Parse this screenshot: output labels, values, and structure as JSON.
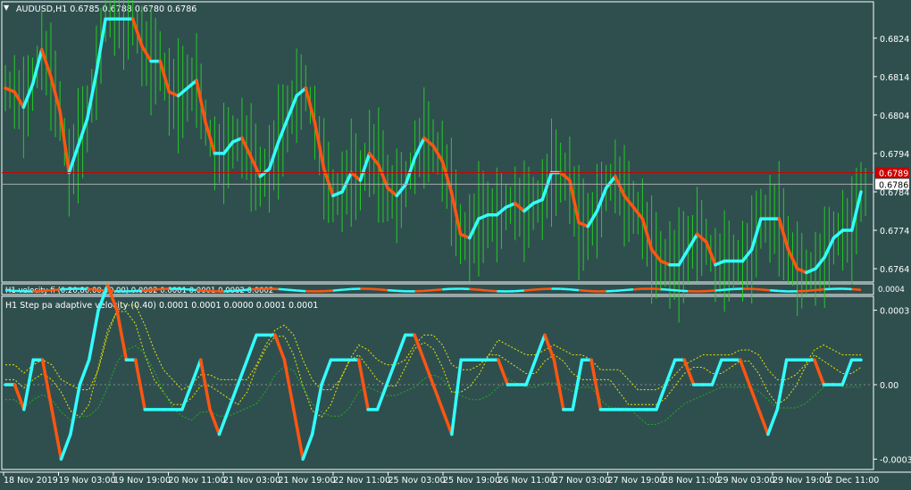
{
  "header": {
    "dropdown_glyph": "▼",
    "symbol_info": "AUDUSD,H1  0.6785 0.6788 0.6780 0.6786"
  },
  "colors": {
    "background": "#2f4f4f",
    "frame": "#ffffff",
    "up": "#33ffff",
    "down": "#ff5511",
    "bars": "#22cc22",
    "level_line": "#cc0000",
    "bid_line": "#aaaaaa",
    "yellow_band": "#e5e500",
    "green_band": "#22aa22"
  },
  "chart_data": [
    {
      "type": "line",
      "name": "price-panel",
      "ylim": [
        0.6761,
        0.6833
      ],
      "yticks": [
        "0.6824",
        "0.6814",
        "0.6804",
        "0.6794",
        "0.6784",
        "0.6774",
        "0.6764"
      ],
      "y_marks": {
        "level": "0.6789",
        "bid": "0.6786"
      },
      "step_line": [
        0.6811,
        0.681,
        0.6806,
        0.6812,
        0.6821,
        0.6814,
        0.6805,
        0.6789,
        0.6796,
        0.6803,
        0.6815,
        0.6829,
        0.6829,
        0.6829,
        0.6829,
        0.6822,
        0.6818,
        0.6818,
        0.681,
        0.6809,
        0.6811,
        0.6813,
        0.6802,
        0.6794,
        0.6794,
        0.6797,
        0.6798,
        0.6793,
        0.6788,
        0.679,
        0.6797,
        0.6803,
        0.6809,
        0.6811,
        0.6802,
        0.679,
        0.6783,
        0.6784,
        0.6789,
        0.6787,
        0.6794,
        0.6791,
        0.6785,
        0.6783,
        0.6786,
        0.6793,
        0.6798,
        0.6796,
        0.6792,
        0.6784,
        0.6773,
        0.6772,
        0.6777,
        0.6778,
        0.6778,
        0.678,
        0.6781,
        0.6779,
        0.6781,
        0.6782,
        0.6789,
        0.6789,
        0.6787,
        0.6776,
        0.6775,
        0.6779,
        0.6785,
        0.6788,
        0.6783,
        0.678,
        0.6777,
        0.6769,
        0.6766,
        0.6765,
        0.6765,
        0.6769,
        0.6773,
        0.6771,
        0.6765,
        0.6766,
        0.6766,
        0.6766,
        0.6769,
        0.6777,
        0.6777,
        0.6777,
        0.6769,
        0.6764,
        0.6763,
        0.6764,
        0.6767,
        0.6772,
        0.6774,
        0.6774,
        0.6784
      ],
      "y_axis_labels": [
        "0.6824",
        "0.6814",
        "0.6804",
        "0.6794",
        "0.6784",
        "0.6774",
        "0.6764"
      ]
    },
    {
      "type": "line",
      "name": "velocity-strip",
      "title": "H1 velocity fi (0.20,80.00,90.00) 0.0002 0.0001 0.0001 0.0002 0.0002",
      "ytick": "0.0004"
    },
    {
      "type": "line",
      "name": "step-pa-adaptive-velocity",
      "title": "H1 Step pa adaptive velocity (0.40) 0.0001 0.0001 0.0000 0.0001 0.0001",
      "ylim": [
        -0.00032,
        0.00032
      ],
      "yticks": [
        "0.0003",
        "0.00",
        "-0.0003"
      ],
      "step_line": [
        0.0,
        0.0,
        -0.0001,
        0.0001,
        0.0001,
        -0.0001,
        -0.0003,
        -0.0002,
        0.0,
        0.0001,
        0.0003,
        0.0004,
        0.0003,
        0.0001,
        0.0001,
        -0.0001,
        -0.0001,
        -0.0001,
        -0.0001,
        -0.0001,
        0.0,
        0.0001,
        -0.0001,
        -0.0002,
        -0.0001,
        0.0,
        0.0001,
        0.0002,
        0.0002,
        0.0002,
        0.0001,
        -0.0001,
        -0.0003,
        -0.0002,
        0.0,
        0.0001,
        0.0001,
        0.0001,
        0.0001,
        -0.0001,
        -0.0001,
        0.0,
        0.0001,
        0.0002,
        0.0002,
        0.0001,
        0.0,
        -0.0001,
        -0.0002,
        0.0001,
        0.0001,
        0.0001,
        0.0001,
        0.0001,
        0.0,
        0.0,
        0.0,
        0.0001,
        0.0002,
        0.0001,
        -0.0001,
        -0.0001,
        0.0001,
        0.0001,
        -0.0001,
        -0.0001,
        -0.0001,
        -0.0001,
        -0.0001,
        -0.0001,
        -0.0001,
        0.0,
        0.0001,
        0.0001,
        0.0,
        0.0,
        0.0,
        0.0001,
        0.0001,
        0.0001,
        0.0,
        -0.0001,
        -0.0002,
        -0.0001,
        0.0001,
        0.0001,
        0.0001,
        0.0001,
        0.0,
        0.0,
        0.0,
        0.0001,
        0.0001
      ],
      "y_axis_labels": [
        "0.0003",
        "0.00",
        "-0.0003"
      ]
    }
  ],
  "x_axis": {
    "labels": [
      "18 Nov 2019",
      "19 Nov 03:00",
      "19 Nov 19:00",
      "20 Nov 11:00",
      "21 Nov 03:00",
      "21 Nov 19:00",
      "22 Nov 11:00",
      "25 Nov 03:00",
      "25 Nov 19:00",
      "26 Nov 11:00",
      "27 Nov 03:00",
      "27 Nov 19:00",
      "28 Nov 11:00",
      "29 Nov 03:00",
      "29 Nov 19:00",
      "2 Dec 11:00"
    ]
  }
}
